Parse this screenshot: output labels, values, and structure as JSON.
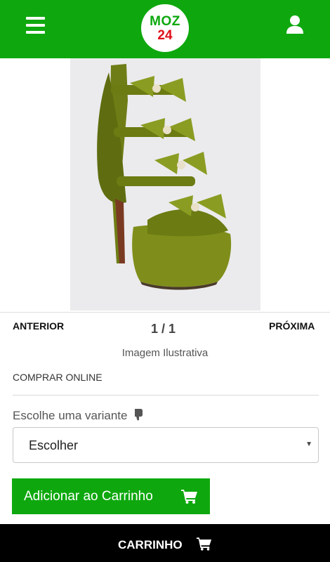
{
  "header": {
    "logo_top": "MOZ",
    "logo_bottom": "24",
    "brand_green": "#0ea80e",
    "logo_red": "#e0101a"
  },
  "gallery": {
    "prev_label": "ANTERIOR",
    "counter": "1 / 1",
    "next_label": "PRÓXIMA",
    "caption": "Imagem Ilustrativa",
    "image_icon": "green-velvet-bow-sandal"
  },
  "purchase": {
    "buy_online": "COMPRAR ONLINE",
    "variant_label": "Escolhe uma variante",
    "variant_icon": "hand-pointing-down-icon",
    "variant_select_value": "Escolher",
    "add_to_cart_label": "Adicionar ao Carrinho"
  },
  "footer": {
    "cart_label": "CARRINHO"
  }
}
